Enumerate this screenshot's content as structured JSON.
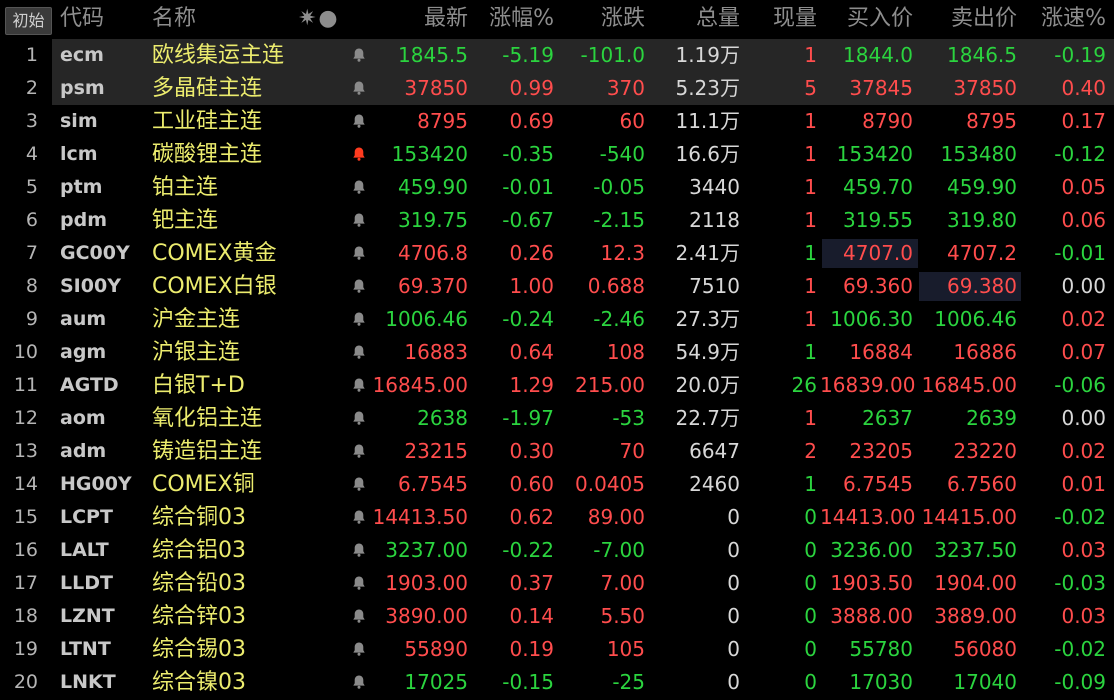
{
  "toolbar": {
    "init_label": "初始"
  },
  "header": {
    "code": "代码",
    "name": "名称",
    "col_icons": "✷●",
    "last": "最新",
    "pct": "涨幅%",
    "chg": "涨跌",
    "vol": "总量",
    "cur": "现量",
    "bid": "买入价",
    "ask": "卖出价",
    "spd": "涨速%"
  },
  "colors": {
    "up": "#ff4d4d",
    "down": "#2bd43f",
    "name": "#ecec6e",
    "bell_active": "#ff3b1f",
    "bell": "#8a8a8a"
  },
  "rows": [
    {
      "idx": "1",
      "code": "ecm",
      "name": "欧线集运主连",
      "bell": "bell-icon",
      "last": "1845.5",
      "pct": "-5.19",
      "chg": "-101.0",
      "vol": "1.19万",
      "cur": "1",
      "bid": "1844.0",
      "ask": "1846.5",
      "spd": "-0.19",
      "t_last": "dn",
      "t_pct": "dn",
      "t_chg": "dn",
      "t_cur": "up",
      "t_bid": "dn",
      "t_ask": "dn",
      "t_spd": "dn",
      "sel": true
    },
    {
      "idx": "2",
      "code": "psm",
      "name": "多晶硅主连",
      "bell": "bell-icon",
      "last": "37850",
      "pct": "0.99",
      "chg": "370",
      "vol": "5.23万",
      "cur": "5",
      "bid": "37845",
      "ask": "37850",
      "spd": "0.40",
      "t_last": "up",
      "t_pct": "up",
      "t_chg": "up",
      "t_cur": "up",
      "t_bid": "up",
      "t_ask": "up",
      "t_spd": "up",
      "sel": true
    },
    {
      "idx": "3",
      "code": "sim",
      "name": "工业硅主连",
      "bell": "bell-icon",
      "last": "8795",
      "pct": "0.69",
      "chg": "60",
      "vol": "11.1万",
      "cur": "1",
      "bid": "8790",
      "ask": "8795",
      "spd": "0.17",
      "t_last": "up",
      "t_pct": "up",
      "t_chg": "up",
      "t_cur": "up",
      "t_bid": "up",
      "t_ask": "up",
      "t_spd": "up"
    },
    {
      "idx": "4",
      "code": "lcm",
      "name": "碳酸锂主连",
      "bell": "bell-active-icon",
      "last": "153420",
      "pct": "-0.35",
      "chg": "-540",
      "vol": "16.6万",
      "cur": "1",
      "bid": "153420",
      "ask": "153480",
      "spd": "-0.12",
      "t_last": "dn",
      "t_pct": "dn",
      "t_chg": "dn",
      "t_cur": "up",
      "t_bid": "dn",
      "t_ask": "dn",
      "t_spd": "dn"
    },
    {
      "idx": "5",
      "code": "ptm",
      "name": "铂主连",
      "bell": "bell-icon",
      "last": "459.90",
      "pct": "-0.01",
      "chg": "-0.05",
      "vol": "3440",
      "cur": "1",
      "bid": "459.70",
      "ask": "459.90",
      "spd": "0.05",
      "t_last": "dn",
      "t_pct": "dn",
      "t_chg": "dn",
      "t_cur": "up",
      "t_bid": "dn",
      "t_ask": "dn",
      "t_spd": "up"
    },
    {
      "idx": "6",
      "code": "pdm",
      "name": "钯主连",
      "bell": "bell-icon",
      "last": "319.75",
      "pct": "-0.67",
      "chg": "-2.15",
      "vol": "2118",
      "cur": "1",
      "bid": "319.55",
      "ask": "319.80",
      "spd": "0.06",
      "t_last": "dn",
      "t_pct": "dn",
      "t_chg": "dn",
      "t_cur": "up",
      "t_bid": "dn",
      "t_ask": "dn",
      "t_spd": "up"
    },
    {
      "idx": "7",
      "code": "GC00Y",
      "name": "COMEX黄金",
      "bell": "bell-icon",
      "last": "4706.8",
      "pct": "0.26",
      "chg": "12.3",
      "vol": "2.41万",
      "cur": "1",
      "bid": "4707.0",
      "ask": "4707.2",
      "spd": "-0.01",
      "t_last": "up",
      "t_pct": "up",
      "t_chg": "up",
      "t_cur": "dn",
      "t_bid": "up",
      "t_ask": "up",
      "t_spd": "dn",
      "hl": "bid"
    },
    {
      "idx": "8",
      "code": "SI00Y",
      "name": "COMEX白银",
      "bell": "bell-icon",
      "last": "69.370",
      "pct": "1.00",
      "chg": "0.688",
      "vol": "7510",
      "cur": "1",
      "bid": "69.360",
      "ask": "69.380",
      "spd": "0.00",
      "t_last": "up",
      "t_pct": "up",
      "t_chg": "up",
      "t_cur": "up",
      "t_bid": "up",
      "t_ask": "up",
      "t_spd": "flat",
      "hl": "ask"
    },
    {
      "idx": "9",
      "code": "aum",
      "name": "沪金主连",
      "bell": "bell-icon",
      "last": "1006.46",
      "pct": "-0.24",
      "chg": "-2.46",
      "vol": "27.3万",
      "cur": "1",
      "bid": "1006.30",
      "ask": "1006.46",
      "spd": "0.02",
      "t_last": "dn",
      "t_pct": "dn",
      "t_chg": "dn",
      "t_cur": "up",
      "t_bid": "dn",
      "t_ask": "dn",
      "t_spd": "up"
    },
    {
      "idx": "10",
      "code": "agm",
      "name": "沪银主连",
      "bell": "bell-icon",
      "last": "16883",
      "pct": "0.64",
      "chg": "108",
      "vol": "54.9万",
      "cur": "1",
      "bid": "16884",
      "ask": "16886",
      "spd": "0.07",
      "t_last": "up",
      "t_pct": "up",
      "t_chg": "up",
      "t_cur": "dn",
      "t_bid": "up",
      "t_ask": "up",
      "t_spd": "up"
    },
    {
      "idx": "11",
      "code": "AGTD",
      "name": "白银T+D",
      "bell": "bell-icon",
      "last": "16845.00",
      "pct": "1.29",
      "chg": "215.00",
      "vol": "20.0万",
      "cur": "26",
      "bid": "16839.00",
      "ask": "16845.00",
      "spd": "-0.06",
      "t_last": "up",
      "t_pct": "up",
      "t_chg": "up",
      "t_cur": "dn",
      "t_bid": "up",
      "t_ask": "up",
      "t_spd": "dn"
    },
    {
      "idx": "12",
      "code": "aom",
      "name": "氧化铝主连",
      "bell": "bell-icon",
      "last": "2638",
      "pct": "-1.97",
      "chg": "-53",
      "vol": "22.7万",
      "cur": "1",
      "bid": "2637",
      "ask": "2639",
      "spd": "0.00",
      "t_last": "dn",
      "t_pct": "dn",
      "t_chg": "dn",
      "t_cur": "up",
      "t_bid": "dn",
      "t_ask": "dn",
      "t_spd": "flat"
    },
    {
      "idx": "13",
      "code": "adm",
      "name": "铸造铝主连",
      "bell": "bell-icon",
      "last": "23215",
      "pct": "0.30",
      "chg": "70",
      "vol": "6647",
      "cur": "2",
      "bid": "23205",
      "ask": "23220",
      "spd": "0.02",
      "t_last": "up",
      "t_pct": "up",
      "t_chg": "up",
      "t_cur": "up",
      "t_bid": "up",
      "t_ask": "up",
      "t_spd": "up"
    },
    {
      "idx": "14",
      "code": "HG00Y",
      "name": "COMEX铜",
      "bell": "bell-icon",
      "last": "6.7545",
      "pct": "0.60",
      "chg": "0.0405",
      "vol": "2460",
      "cur": "1",
      "bid": "6.7545",
      "ask": "6.7560",
      "spd": "0.01",
      "t_last": "up",
      "t_pct": "up",
      "t_chg": "up",
      "t_cur": "dn",
      "t_bid": "up",
      "t_ask": "up",
      "t_spd": "up"
    },
    {
      "idx": "15",
      "code": "LCPT",
      "name": "综合铜03",
      "bell": "bell-icon",
      "last": "14413.50",
      "pct": "0.62",
      "chg": "89.00",
      "vol": "0",
      "cur": "0",
      "bid": "14413.00",
      "ask": "14415.00",
      "spd": "-0.02",
      "t_last": "up",
      "t_pct": "up",
      "t_chg": "up",
      "t_cur": "dn",
      "t_bid": "up",
      "t_ask": "up",
      "t_spd": "dn"
    },
    {
      "idx": "16",
      "code": "LALT",
      "name": "综合铝03",
      "bell": "bell-icon",
      "last": "3237.00",
      "pct": "-0.22",
      "chg": "-7.00",
      "vol": "0",
      "cur": "0",
      "bid": "3236.00",
      "ask": "3237.50",
      "spd": "0.03",
      "t_last": "dn",
      "t_pct": "dn",
      "t_chg": "dn",
      "t_cur": "dn",
      "t_bid": "dn",
      "t_ask": "dn",
      "t_spd": "up"
    },
    {
      "idx": "17",
      "code": "LLDT",
      "name": "综合铅03",
      "bell": "bell-icon",
      "last": "1903.00",
      "pct": "0.37",
      "chg": "7.00",
      "vol": "0",
      "cur": "0",
      "bid": "1903.50",
      "ask": "1904.00",
      "spd": "-0.03",
      "t_last": "up",
      "t_pct": "up",
      "t_chg": "up",
      "t_cur": "dn",
      "t_bid": "up",
      "t_ask": "up",
      "t_spd": "dn"
    },
    {
      "idx": "18",
      "code": "LZNT",
      "name": "综合锌03",
      "bell": "bell-icon",
      "last": "3890.00",
      "pct": "0.14",
      "chg": "5.50",
      "vol": "0",
      "cur": "0",
      "bid": "3888.00",
      "ask": "3889.00",
      "spd": "0.03",
      "t_last": "up",
      "t_pct": "up",
      "t_chg": "up",
      "t_cur": "dn",
      "t_bid": "up",
      "t_ask": "up",
      "t_spd": "up"
    },
    {
      "idx": "19",
      "code": "LTNT",
      "name": "综合锡03",
      "bell": "bell-icon",
      "last": "55890",
      "pct": "0.19",
      "chg": "105",
      "vol": "0",
      "cur": "0",
      "bid": "55780",
      "ask": "56080",
      "spd": "-0.02",
      "t_last": "up",
      "t_pct": "up",
      "t_chg": "up",
      "t_cur": "dn",
      "t_bid": "dn",
      "t_ask": "up",
      "t_spd": "dn"
    },
    {
      "idx": "20",
      "code": "LNKT",
      "name": "综合镍03",
      "bell": "bell-icon",
      "last": "17025",
      "pct": "-0.15",
      "chg": "-25",
      "vol": "0",
      "cur": "0",
      "bid": "17030",
      "ask": "17040",
      "spd": "-0.09",
      "t_last": "dn",
      "t_pct": "dn",
      "t_chg": "dn",
      "t_cur": "dn",
      "t_bid": "dn",
      "t_ask": "dn",
      "t_spd": "dn"
    }
  ]
}
